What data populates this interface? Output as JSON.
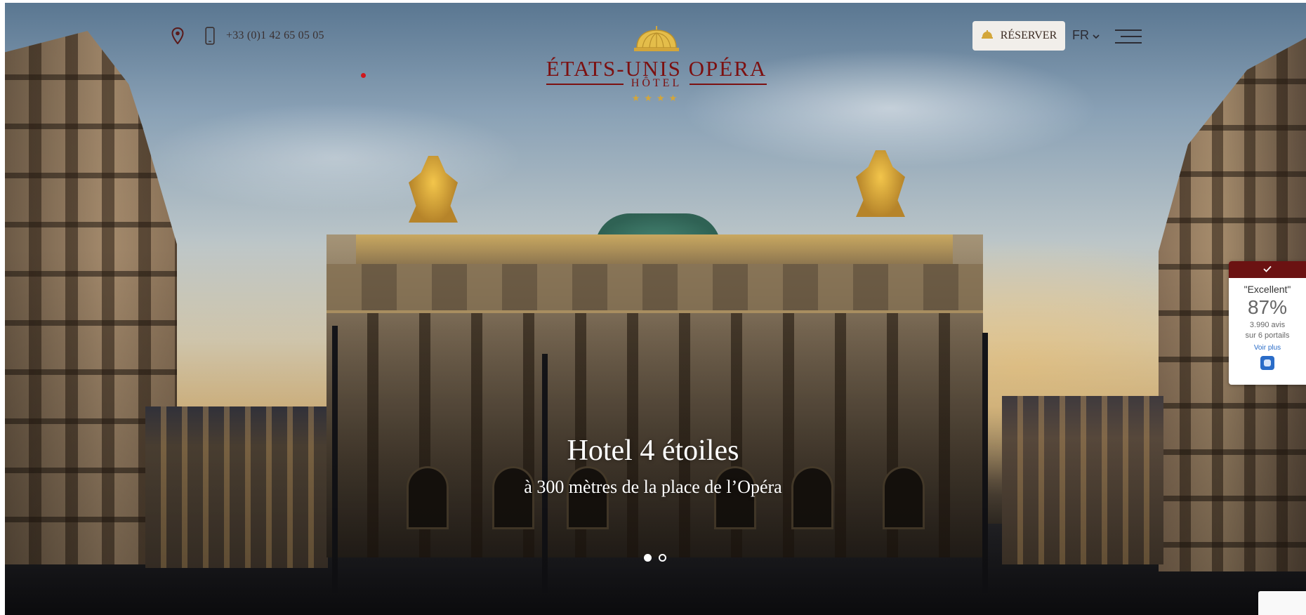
{
  "contact": {
    "location_icon": "map-pin-icon",
    "phone_icon": "mobile-phone-icon",
    "phone": "+33 (0)1 42 65 05 05"
  },
  "logo": {
    "name": "ÉTATS-UNIS OPÉRA",
    "subtitle": "HÔTEL",
    "stars": "★★★★",
    "icon": "opera-dome-logo-icon"
  },
  "header": {
    "reserve_label": "RÉSERVER",
    "reserve_icon": "service-bell-icon",
    "language": "FR",
    "menu_icon": "hamburger-menu-icon"
  },
  "hero": {
    "title": "Hotel 4 étoiles",
    "subtitle": "à 300 mètres de la place de l’Opéra",
    "slides": 2,
    "active_slide": 1
  },
  "review_widget": {
    "rating": "\"Excellent\"",
    "score": "87%",
    "reviews": "3.990 avis",
    "portals": "sur 6 portails",
    "more": "Voir plus",
    "check_icon": "checkmark-icon"
  },
  "colors": {
    "brand": "#7c1010",
    "accent_gold": "#d3a63a",
    "review_header": "#6b1212",
    "link": "#2a6cc8"
  }
}
